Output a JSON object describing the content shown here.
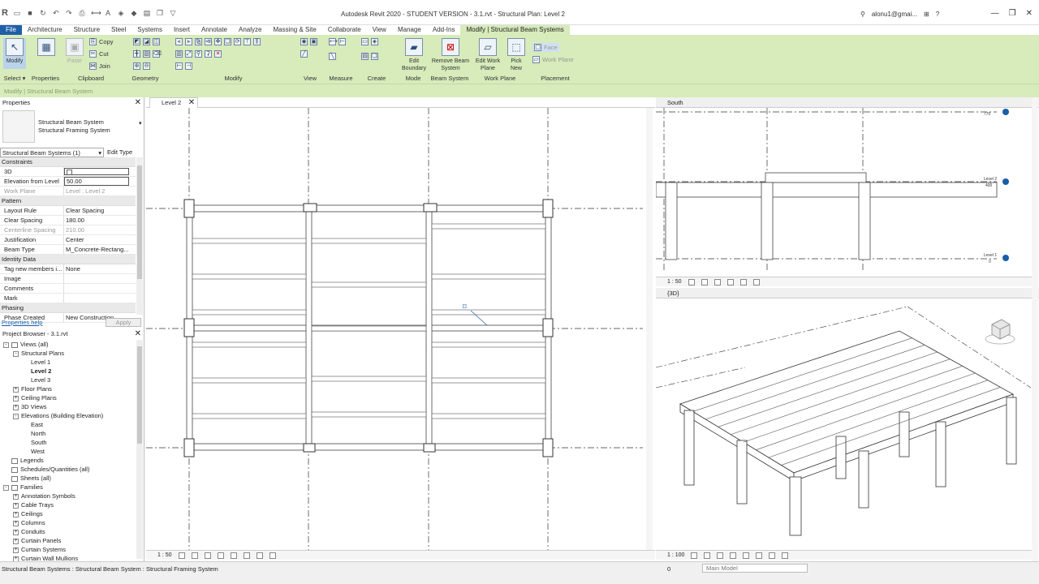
{
  "app": {
    "title": "Autodesk Revit 2020 - STUDENT VERSION - 3.1.rvt - Structural Plan: Level 2",
    "user": "alonu1@gmai...",
    "logo": "R"
  },
  "tabs": [
    "File",
    "Architecture",
    "Structure",
    "Steel",
    "Systems",
    "Insert",
    "Annotate",
    "Analyze",
    "Massing & Site",
    "Collaborate",
    "View",
    "Manage",
    "Add-Ins",
    "Modify | Structural Beam Systems"
  ],
  "ribbon": {
    "select": {
      "label": "Select",
      "modify": "Modify"
    },
    "properties": {
      "label": "Properties"
    },
    "clipboard": {
      "label": "Clipboard",
      "paste": "Paste",
      "copy": "Copy",
      "cut": "Cut",
      "join": "Join"
    },
    "geometry": {
      "label": "Geometry"
    },
    "modify": {
      "label": "Modify"
    },
    "view": {
      "label": "View"
    },
    "measure": {
      "label": "Measure"
    },
    "create": {
      "label": "Create"
    },
    "mode": {
      "label": "Mode",
      "edit_boundary": "Edit Boundary"
    },
    "beam_system": {
      "label": "Beam System",
      "remove": "Remove Beam System"
    },
    "work_plane": {
      "label": "Work Plane",
      "edit": "Edit Work Plane"
    },
    "placement": {
      "label": "Placement",
      "pick_new": "Pick New",
      "face": "Face",
      "work_plane": "Work Plane"
    }
  },
  "context_bar": "Modify | Structural Beam System",
  "properties": {
    "header": "Properties",
    "type_line1": "Structural Beam System",
    "type_line2": "Structural Framing System",
    "filter": "Structural Beam Systems (1)",
    "edit_type": "Edit Type",
    "groups": [
      {
        "name": "Constraints",
        "rows": [
          {
            "k": "3D",
            "v": ""
          },
          {
            "k": "Elevation from Level",
            "v": "50.00"
          },
          {
            "k": "Work Plane",
            "v": "Level : Level 2",
            "grey": true
          }
        ]
      },
      {
        "name": "Pattern",
        "rows": [
          {
            "k": "Layout Rule",
            "v": "Clear Spacing"
          },
          {
            "k": "Clear Spacing",
            "v": "180.00"
          },
          {
            "k": "Centerline Spacing",
            "v": "210.00",
            "grey": true
          },
          {
            "k": "Justification",
            "v": "Center"
          },
          {
            "k": "Beam Type",
            "v": "M_Concrete-Rectang..."
          }
        ]
      },
      {
        "name": "Identity Data",
        "rows": [
          {
            "k": "Tag new members i...",
            "v": "None"
          },
          {
            "k": "Image",
            "v": ""
          },
          {
            "k": "Comments",
            "v": ""
          },
          {
            "k": "Mark",
            "v": ""
          }
        ]
      },
      {
        "name": "Phasing",
        "rows": [
          {
            "k": "Phase Created",
            "v": "New Construction"
          }
        ]
      }
    ],
    "help": "Properties help",
    "apply": "Apply"
  },
  "browser": {
    "header": "Project Browser - 3.1.rvt",
    "nodes": [
      {
        "t": "Views (all)",
        "lvl": 0,
        "tg": "-",
        "icon": true
      },
      {
        "t": "Structural Plans",
        "lvl": 1,
        "tg": "-"
      },
      {
        "t": "Level 1",
        "lvl": 2
      },
      {
        "t": "Level 2",
        "lvl": 2,
        "bold": true
      },
      {
        "t": "Level 3",
        "lvl": 2
      },
      {
        "t": "Floor Plans",
        "lvl": 1,
        "tg": "+"
      },
      {
        "t": "Ceiling Plans",
        "lvl": 1,
        "tg": "+"
      },
      {
        "t": "3D Views",
        "lvl": 1,
        "tg": "+"
      },
      {
        "t": "Elevations (Building Elevation)",
        "lvl": 1,
        "tg": "-"
      },
      {
        "t": "East",
        "lvl": 2
      },
      {
        "t": "North",
        "lvl": 2
      },
      {
        "t": "South",
        "lvl": 2
      },
      {
        "t": "West",
        "lvl": 2
      },
      {
        "t": "Legends",
        "lvl": 0,
        "icon": true
      },
      {
        "t": "Schedules/Quantities (all)",
        "lvl": 0,
        "icon": true
      },
      {
        "t": "Sheets (all)",
        "lvl": 0,
        "icon": true
      },
      {
        "t": "Families",
        "lvl": 0,
        "tg": "-",
        "icon": true
      },
      {
        "t": "Annotation Symbols",
        "lvl": 1,
        "tg": "+"
      },
      {
        "t": "Cable Trays",
        "lvl": 1,
        "tg": "+"
      },
      {
        "t": "Ceilings",
        "lvl": 1,
        "tg": "+"
      },
      {
        "t": "Columns",
        "lvl": 1,
        "tg": "+"
      },
      {
        "t": "Conduits",
        "lvl": 1,
        "tg": "+"
      },
      {
        "t": "Curtain Panels",
        "lvl": 1,
        "tg": "+"
      },
      {
        "t": "Curtain Systems",
        "lvl": 1,
        "tg": "+"
      },
      {
        "t": "Curtain Wall Mullions",
        "lvl": 1,
        "tg": "+"
      }
    ]
  },
  "views": {
    "plan": {
      "tab": "Level 2",
      "scale": "1 : 50"
    },
    "south": {
      "title": "South",
      "scale": "1 : 50",
      "tags": [
        {
          "name": "Level 2",
          "elev": "400"
        },
        {
          "name": "Level 1",
          "elev": "0"
        }
      ],
      "top_elev": "770"
    },
    "three_d": {
      "title": "{3D}",
      "scale": "1 : 100"
    }
  },
  "status": {
    "message": "Structural Beam Systems : Structural Beam System : Structural Framing System",
    "zero": "0",
    "model": "Main Model"
  }
}
